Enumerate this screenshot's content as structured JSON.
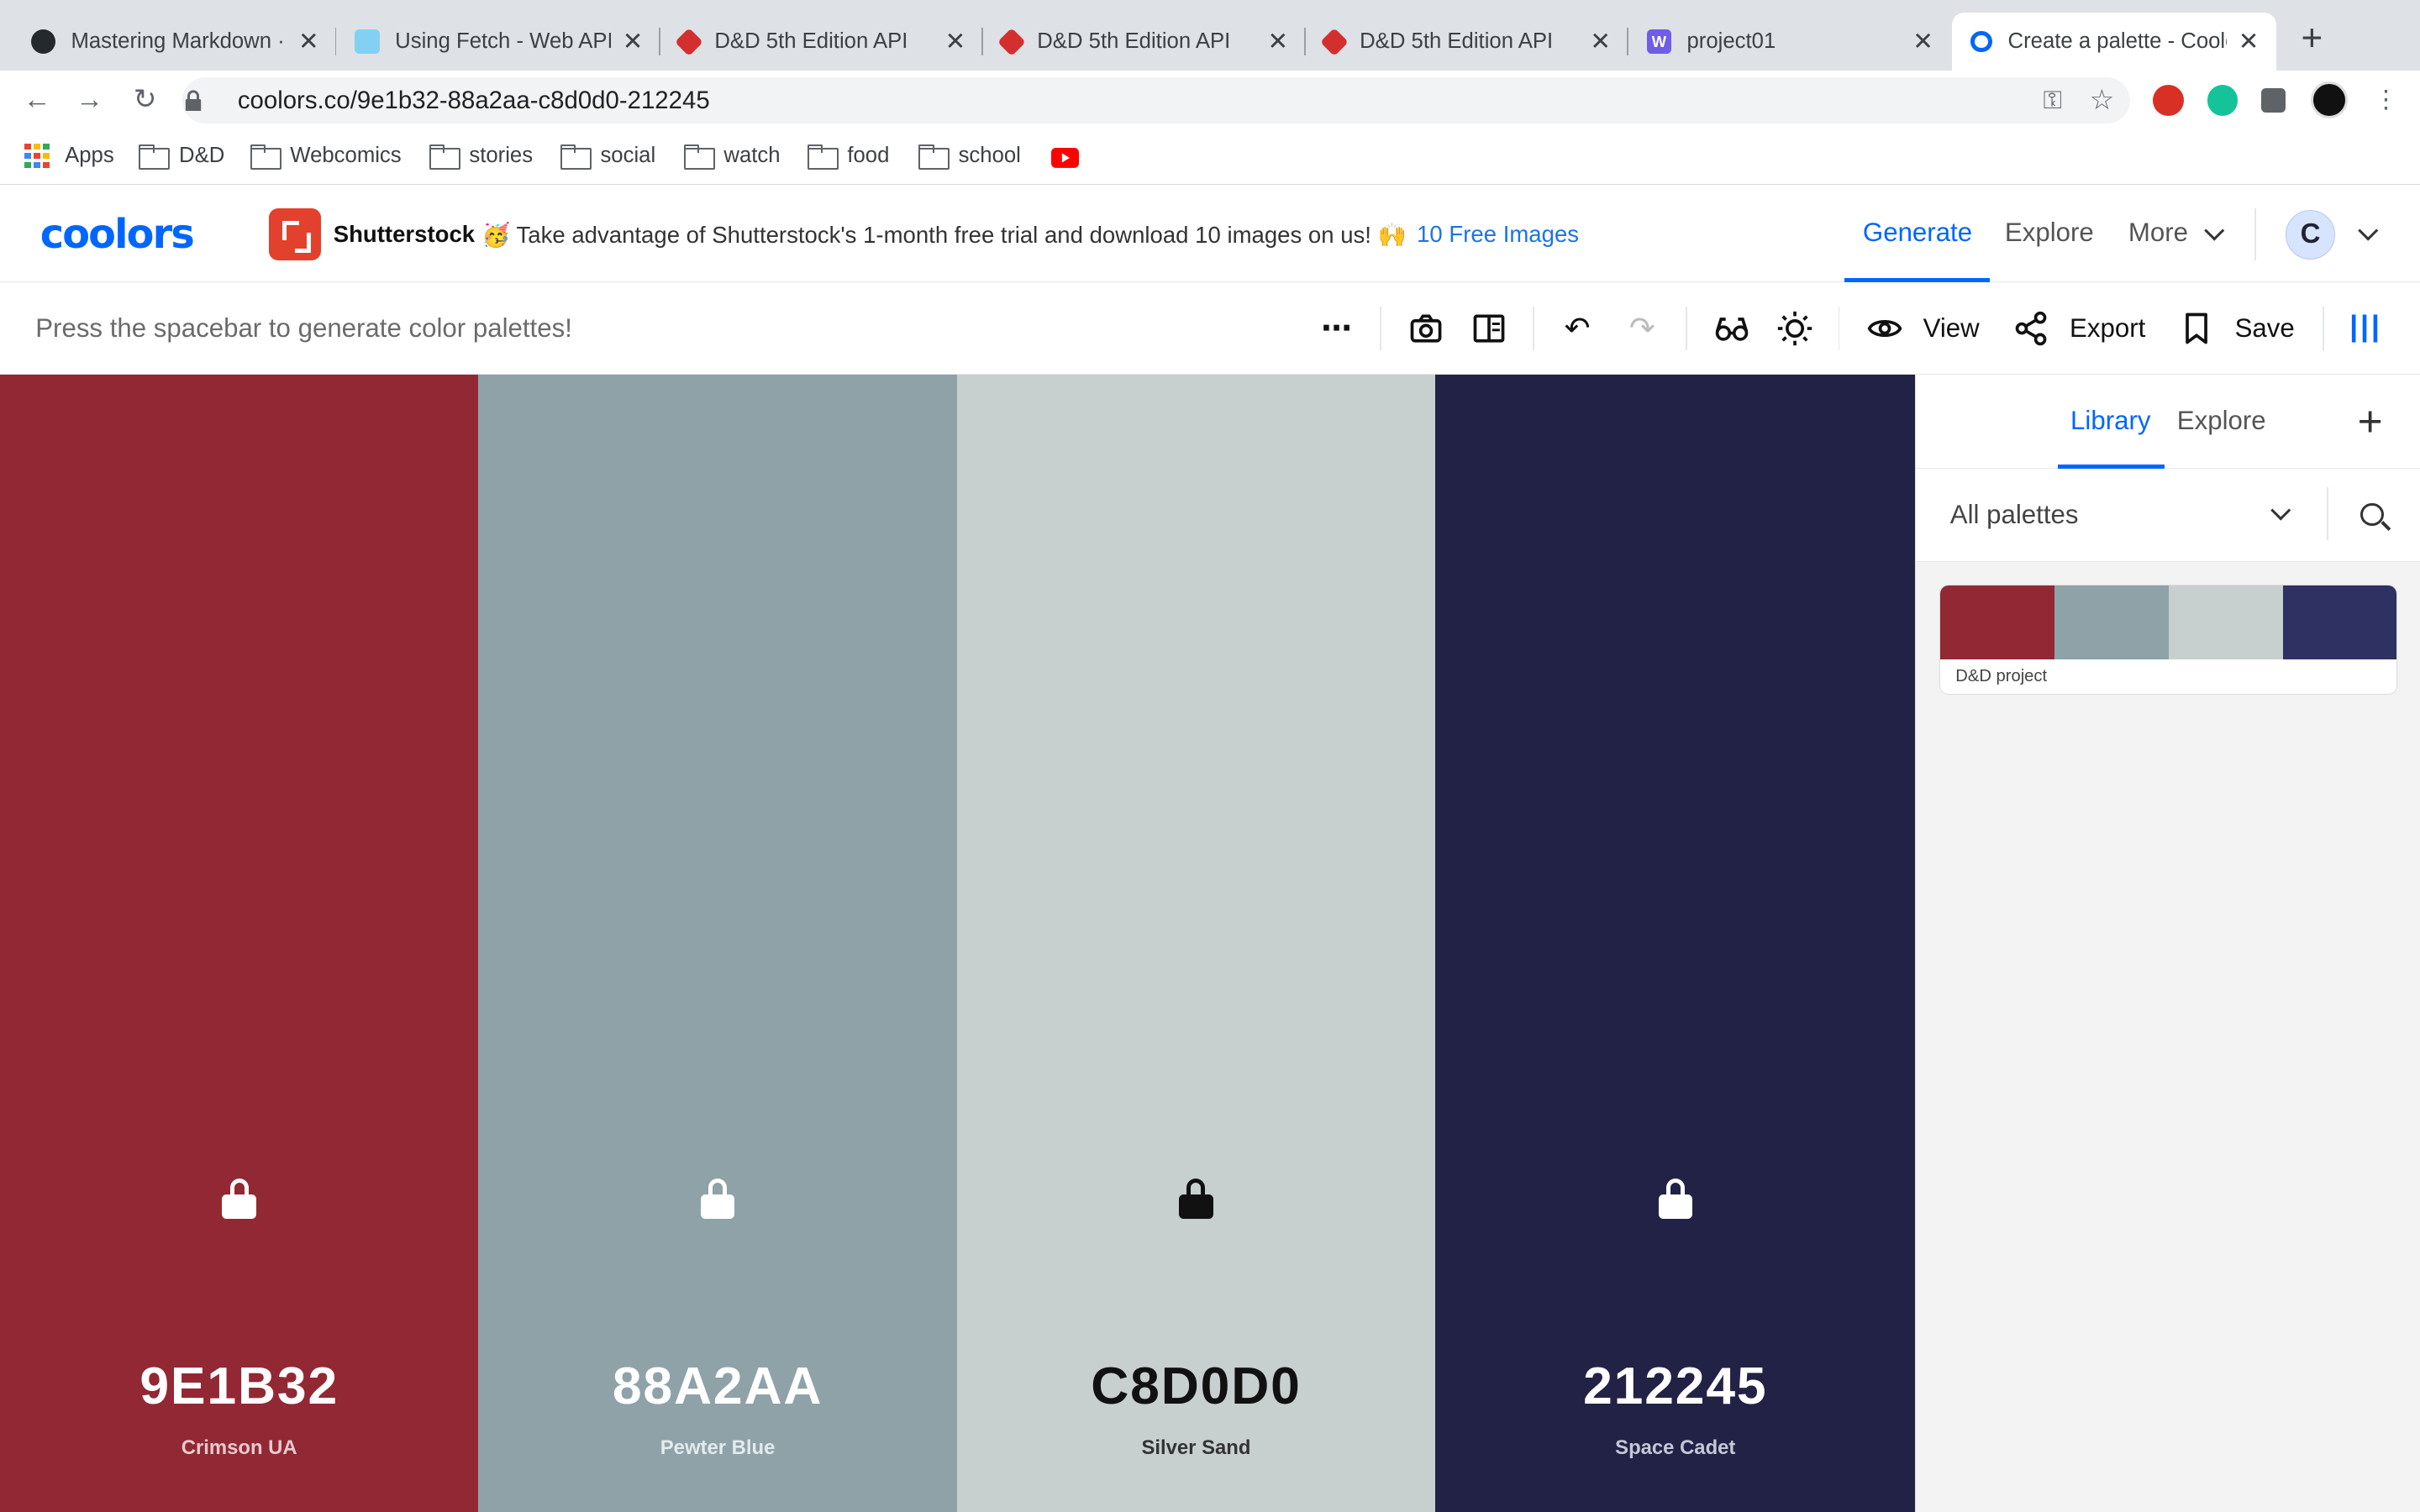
{
  "browser": {
    "tabs": [
      {
        "title": "Mastering Markdown · ",
        "favicon": "github-icon",
        "active": false
      },
      {
        "title": "Using Fetch - Web API",
        "favicon": "mdn-icon",
        "active": false
      },
      {
        "title": "D&D 5th Edition API",
        "favicon": "d20-icon",
        "active": false
      },
      {
        "title": "D&D 5th Edition API",
        "favicon": "d20-icon",
        "active": false
      },
      {
        "title": "D&D 5th Edition API",
        "favicon": "d20-icon",
        "active": false
      },
      {
        "title": "project01",
        "favicon": "webflow-icon",
        "active": false
      },
      {
        "title": "Create a palette - Coolors",
        "favicon": "coolors-icon",
        "active": true
      }
    ],
    "url": "coolors.co/9e1b32-88a2aa-c8d0d0-212245",
    "bookmarks": [
      "Apps",
      "D&D",
      "Webcomics",
      "stories",
      "social",
      "watch",
      "food",
      "school"
    ]
  },
  "header": {
    "logo": "coolors",
    "ad_brand": "Shutterstock",
    "ad_text": "🥳 Take advantage of Shutterstock's 1-month free trial and download 10 images on us! 🙌",
    "ad_link": "10 Free Images",
    "nav": {
      "generate": "Generate",
      "explore": "Explore",
      "more": "More"
    },
    "avatar_letter": "C"
  },
  "toolbar": {
    "hint": "Press the spacebar to generate color palettes!",
    "view_label": "View",
    "export_label": "Export",
    "save_label": "Save"
  },
  "palette": [
    {
      "hex": "9E1B32",
      "name": "Crimson UA",
      "color": "#922833",
      "text_color": "#ffffff",
      "name_color": "#e8c9cd"
    },
    {
      "hex": "88A2AA",
      "name": "Pewter Blue",
      "color": "#8ea2a8",
      "text_color": "#ffffff",
      "name_color": "#e3eaec"
    },
    {
      "hex": "C8D0D0",
      "name": "Silver Sand",
      "color": "#c7d0cf",
      "text_color": "#111111",
      "name_color": "#333333"
    },
    {
      "hex": "212245",
      "name": "Space Cadet",
      "color": "#212245",
      "text_color": "#ffffff",
      "name_color": "#c6c7d6"
    }
  ],
  "panel": {
    "tabs": {
      "library": "Library",
      "explore": "Explore"
    },
    "filter_label": "All palettes",
    "saved": [
      {
        "name": "D&D project",
        "colors": [
          "#922833",
          "#8ea2a8",
          "#c7d0cf",
          "#2f3163"
        ]
      }
    ]
  }
}
